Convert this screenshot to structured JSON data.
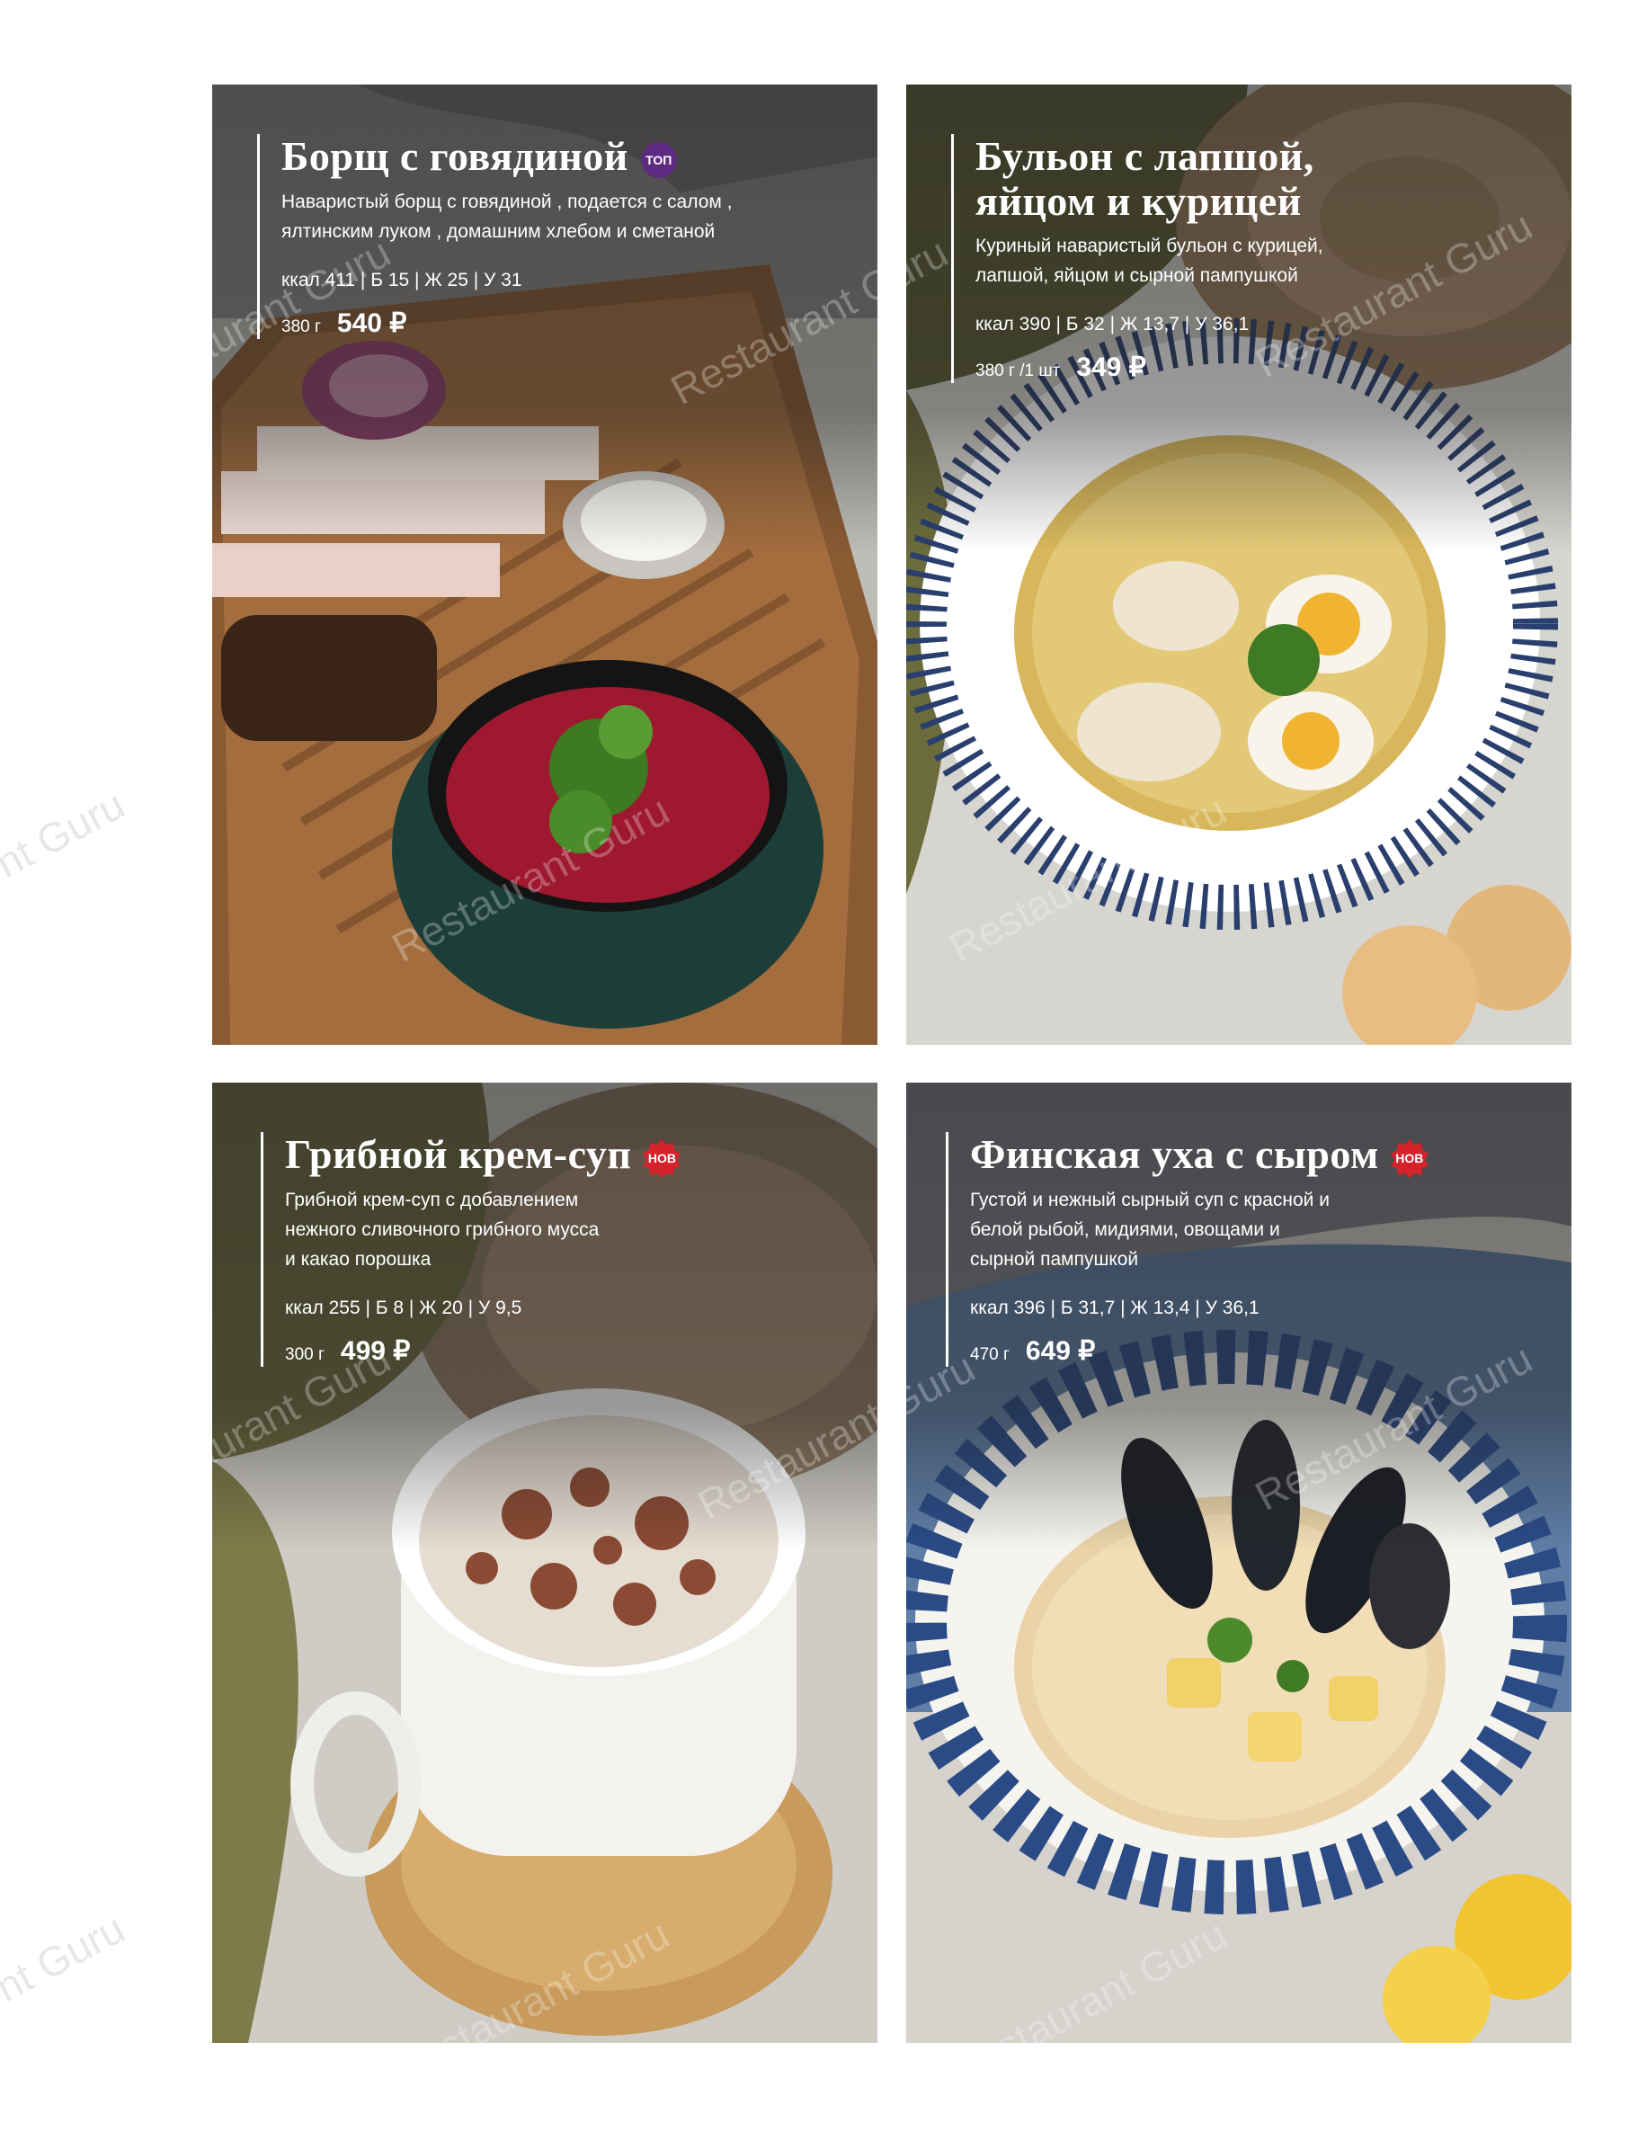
{
  "watermark": "Restaurant Guru",
  "watermark_short": "nt Guru",
  "dishes": [
    {
      "title": "Борщ с говядиной",
      "badge": "ТОП",
      "badge_color": "#5e2a82",
      "description": "Наваристый борщ с говядиной , подается с салом , ялтинским луком , домашним хлебом и сметаной",
      "macros": "ккал 411 | Б 15 | Ж 25 | У 31",
      "weight": "380 г",
      "price": "540 ₽"
    },
    {
      "title": "Бульон с лапшой, яйцом и курицей",
      "badge": "",
      "description": "Куриный наваристый бульон с курицей, лапшой, яйцом и сырной пампушкой",
      "macros": "ккал 390 | Б 32 | Ж 13,7 | У 36,1",
      "weight": "380 г /1 шт",
      "price": "349 ₽"
    },
    {
      "title": "Грибной крем-суп",
      "badge": "НОВ",
      "badge_color": "#d4232a",
      "description": "Грибной крем-суп с добавлением нежного сливочного грибного мусса и какао порошка",
      "macros": "ккал 255 | Б 8 | Ж 20 | У 9,5",
      "weight": "300 г",
      "price": "499 ₽"
    },
    {
      "title": "Финская уха с сыром",
      "badge": "НОВ",
      "badge_color": "#d4232a",
      "description": "Густой и нежный сырный суп с красной и белой рыбой, мидиями, овощами и сырной пампушкой",
      "macros": "ккал 396 | Б 31,7 | Ж 13,4 | У 36,1",
      "weight": "470 г",
      "price": "649 ₽"
    }
  ]
}
